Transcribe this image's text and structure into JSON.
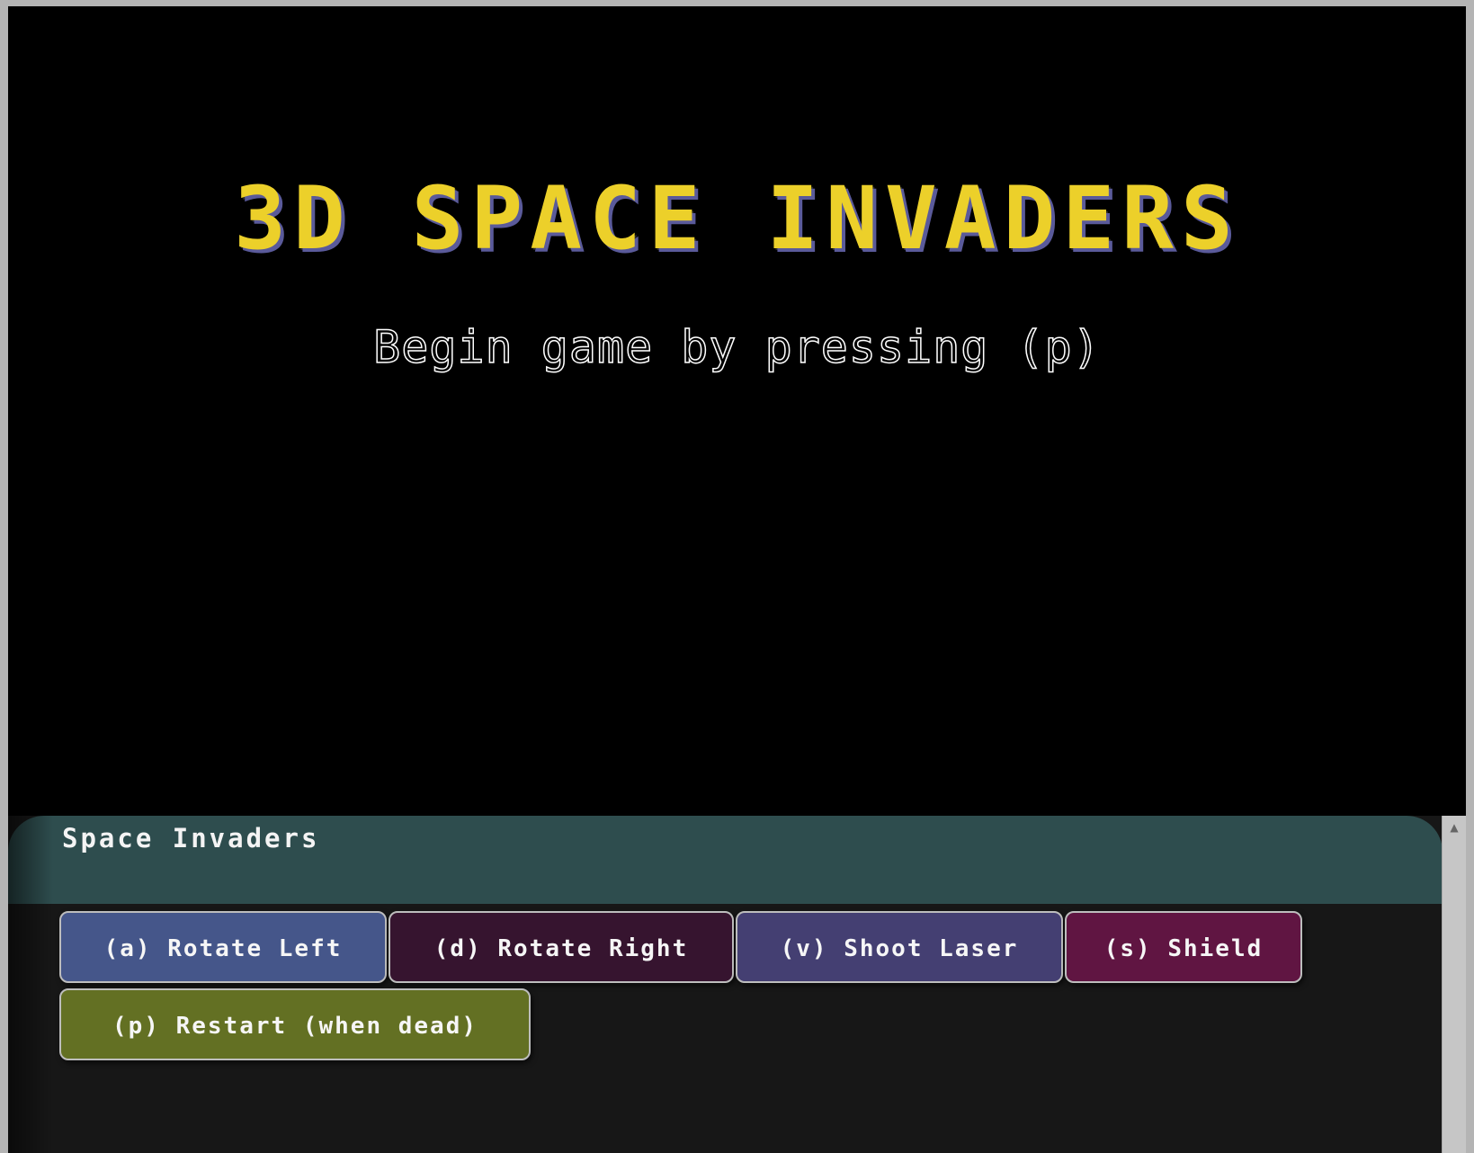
{
  "game": {
    "title": "3D SPACE INVADERS",
    "subtitle": "Begin game by pressing (p)"
  },
  "panel": {
    "title": "Space Invaders"
  },
  "controls": [
    {
      "label": "(a) Rotate Left",
      "color": "#45568a"
    },
    {
      "label": "(d) Rotate Right",
      "color": "#36142f"
    },
    {
      "label": "(v) Shoot Laser",
      "color": "#443f72"
    },
    {
      "label": "(s) Shield",
      "color": "#601542"
    },
    {
      "label": "(p) Restart (when dead)",
      "color": "#637023"
    }
  ],
  "colors": {
    "title": "#ecd02a",
    "title_shadow": "#5a5a9a",
    "panel_header": "#2e4d4e",
    "panel_body": "#171717"
  },
  "icons": {
    "scroll_up": "triangle-up"
  }
}
